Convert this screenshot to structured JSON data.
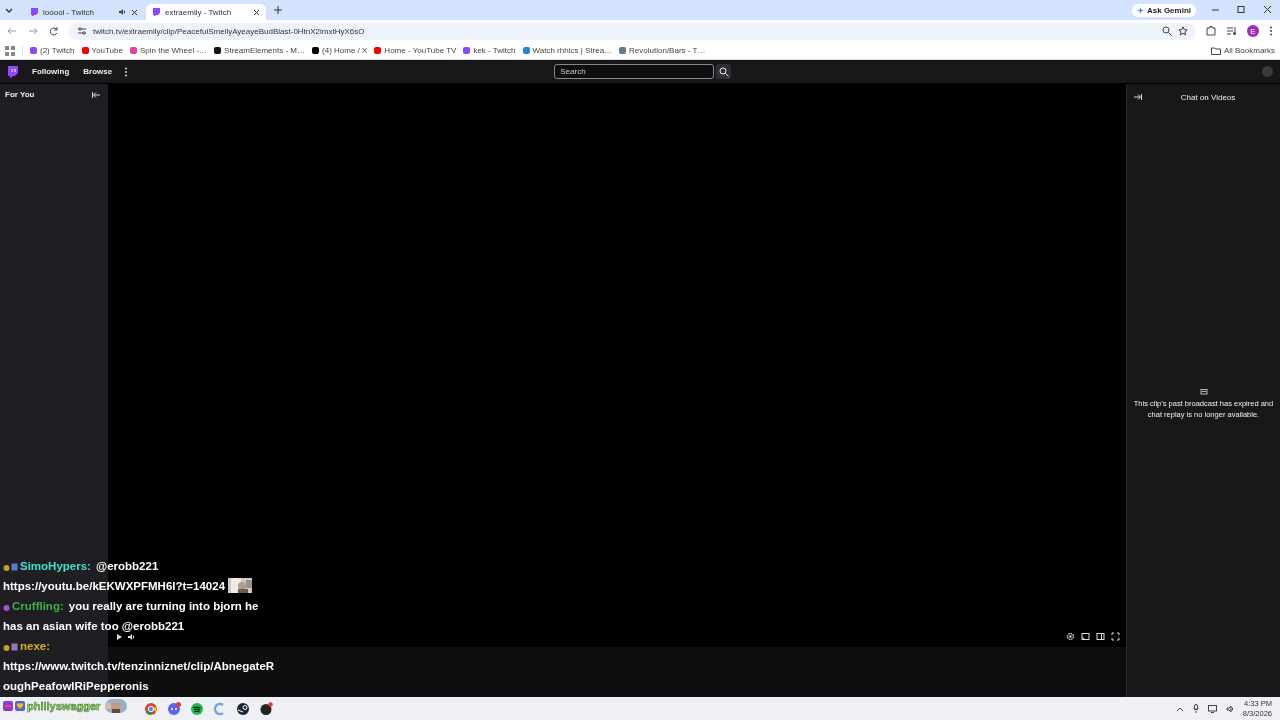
{
  "browser": {
    "tabs": [
      {
        "title": "looool - Twitch",
        "selected": false,
        "audio": true
      },
      {
        "title": "extraemily - Twitch",
        "selected": true,
        "audio": false
      }
    ],
    "ask_gemini": "Ask Gemini",
    "url": "twitch.tv/extraemily/clip/PeacefulSmellyAyeayeBudBlast-0HtnX2imxtHyX6sO",
    "profile_initial": "E",
    "bookmarks": [
      {
        "title": "(2) Twitch",
        "color": "#9146ff"
      },
      {
        "title": "YouTube",
        "color": "#ff0000"
      },
      {
        "title": "Spin the Wheel -…",
        "color": "#e040a0"
      },
      {
        "title": "StreamElements - M…",
        "color": "#111111"
      },
      {
        "title": "(4) Home / X",
        "color": "#000000"
      },
      {
        "title": "Home - YouTube TV",
        "color": "#ff0000"
      },
      {
        "title": "kek - Twitch",
        "color": "#9146ff"
      },
      {
        "title": "Watch rhhlcs | Strea…",
        "color": "#1e88e5"
      },
      {
        "title": "Revolution/Bars - T…",
        "color": "#607d8b"
      }
    ],
    "all_bookmarks": "All Bookmarks"
  },
  "twitch": {
    "nav": [
      "Following",
      "Browse"
    ],
    "search": {
      "placeholder": "Search"
    },
    "sidebar": {
      "title": "For You"
    },
    "chat_panel": {
      "title": "Chat on Videos",
      "message": "This clip's past broadcast has expired and chat replay is no longer available."
    }
  },
  "overlay": {
    "messages": [
      {
        "user": "SimoHypers:",
        "color": "#3ee0d0",
        "inline": "@erobb221",
        "lines": [
          "https://youtu.be/kEKWXPFMH6I?t=14024"
        ],
        "emote": true
      },
      {
        "user": "Cruffling:",
        "color": "#3cb043",
        "inline": "you really are turning into bjorn he",
        "lines": [
          "has an asian wife too @erobb221"
        ]
      },
      {
        "user": "nexe:",
        "color": "#d4b020",
        "lines": [
          "https://www.twitch.tv/tenzinniznet/clip/AbnegateR",
          "oughPeafowlRiPepperonis"
        ]
      }
    ],
    "streamer": "phillyswagger"
  },
  "taskbar": {
    "time": "4:33 PM",
    "date": "8/3/2026"
  }
}
